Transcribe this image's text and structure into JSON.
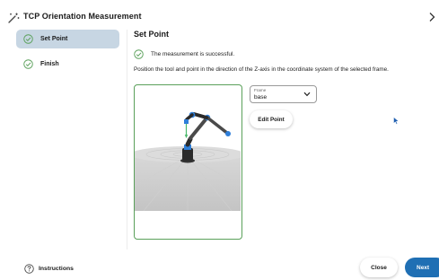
{
  "app": {
    "title": "TCP Orientation Measurement"
  },
  "sidebar": {
    "steps": [
      {
        "label": "Set Point",
        "active": true
      },
      {
        "label": "Finish",
        "active": false
      }
    ]
  },
  "main": {
    "title": "Set Point",
    "status": "The measurement is successful.",
    "instruction": "Position the tool and point in the direction of the Z-axis in the coordinate system of the selected frame.",
    "frame": {
      "label": "Frame",
      "value": "base"
    },
    "edit_button": "Edit Point"
  },
  "footer": {
    "instructions": "Instructions",
    "close": "Close",
    "next": "Next"
  },
  "colors": {
    "accent": "#1f6fb4",
    "success": "#5aa05a",
    "active_step_bg": "#c7d6e3",
    "robot_joint": "#2f7fd9"
  },
  "icons": [
    "magic-wand-icon",
    "chevron-right-icon",
    "check-circle-icon",
    "chevron-down-icon",
    "help-circle-icon",
    "mouse-pointer-icon"
  ]
}
